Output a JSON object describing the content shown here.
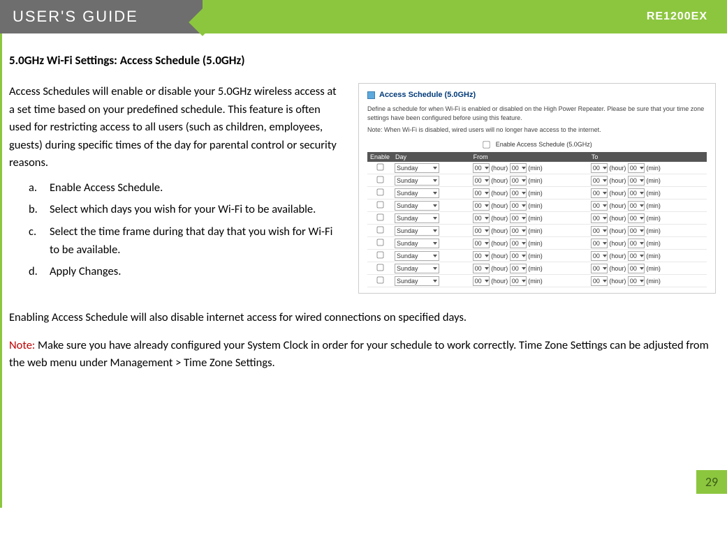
{
  "header": {
    "guide": "USER'S GUIDE",
    "model": "RE1200EX"
  },
  "section_title": "5.0GHz Wi-Fi Settings: Access Schedule (5.0GHz)",
  "intro": "Access Schedules will enable or disable your 5.0GHz wireless access at a set time based on your predefined schedule.  This feature is often used for restricting access to all users (such as children, employees, guests) during specific times of the day for parental control or security reasons.",
  "steps": {
    "a": {
      "marker": "a.",
      "text": "Enable Access Schedule."
    },
    "b": {
      "marker": "b.",
      "text": "Select which days you wish for your Wi-Fi to be available."
    },
    "c": {
      "marker": "c.",
      "text": "Select the time frame during that day that you wish for Wi-Fi to be available."
    },
    "d": {
      "marker": "d.",
      "text": "Apply Changes."
    }
  },
  "panel": {
    "title": "Access Schedule (5.0GHz)",
    "desc": "Define a schedule for when Wi-Fi is enabled or disabled on the High Power Repeater. Please be sure that your time zone settings have been configured before using this feature.",
    "note": "Note: When Wi-Fi is disabled, wired users will no longer have access to the internet.",
    "enable_label": "Enable Access Schedule (5.0GHz)",
    "columns": {
      "enable": "Enable",
      "day": "Day",
      "from": "From",
      "to": "To"
    },
    "row": {
      "day": "Sunday",
      "hour": "00",
      "min": "00",
      "hour_unit": "(hour)",
      "min_unit": "(min)"
    },
    "row_count": 10
  },
  "after1": "Enabling Access Schedule will also disable internet access for wired connections on specified days.",
  "note_label": "Note:",
  "note_body": "  Make sure you have already configured your System Clock in order for your schedule to work correctly.  Time Zone Settings can be adjusted from the web menu under Management > Time Zone Settings.",
  "page_number": "29"
}
